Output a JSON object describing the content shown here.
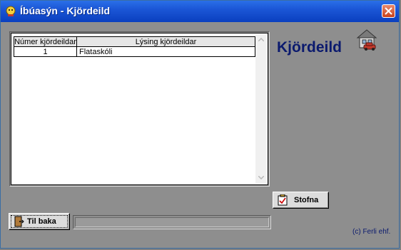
{
  "window": {
    "title": "Íbúasýn - Kjördeild",
    "title_icon": "app-icon",
    "close_icon": "close-icon"
  },
  "grid": {
    "columns": [
      "Númer kjördeildar",
      "Lýsing kjördeildar"
    ],
    "rows": [
      {
        "number": "1",
        "description": "Flataskóli"
      }
    ]
  },
  "heading": {
    "text": "Kjördeild",
    "icon": "house-car-icon"
  },
  "buttons": {
    "create_label": "Stofna",
    "create_icon": "clipboard-check-icon",
    "back_label": "Til baka",
    "back_icon": "door-exit-icon"
  },
  "status": {
    "text": ""
  },
  "footer": {
    "copyright": "(c) Ferli ehf."
  },
  "colors": {
    "titlebar": "#1b56d6",
    "heading": "#0b1a6e",
    "background": "#8e8e8e"
  }
}
